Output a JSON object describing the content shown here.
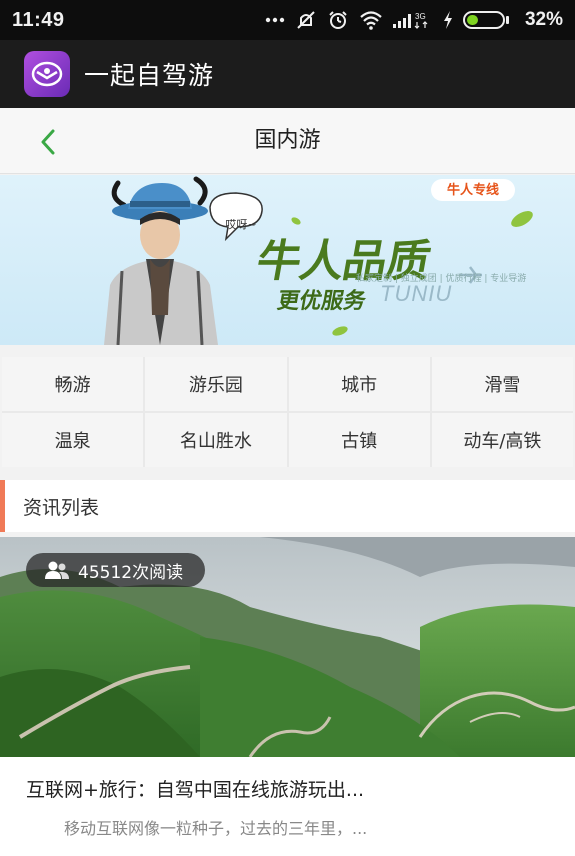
{
  "status_bar": {
    "time": "11:49",
    "signal_label": "3G",
    "battery_percent": "32%",
    "battery_level": 0.32,
    "icons": [
      "more-icon",
      "mute-icon",
      "alarm-icon",
      "wifi-icon",
      "signal-icon",
      "charging-icon",
      "battery-icon"
    ]
  },
  "app_bar": {
    "title": "一起自驾游",
    "icon": "app-logo-icon"
  },
  "header": {
    "title": "国内游",
    "back_icon": "chevron-left-icon"
  },
  "banner": {
    "logo_text": "牛人专线",
    "slogan_main": "牛人品质",
    "slogan_sub": "更优服务",
    "brand": "TUNIU",
    "small_text": "私家定制 | 独立成团 | 优质行程 | 专业导游",
    "speech_text": "哎呀~"
  },
  "categories": [
    {
      "label": "畅游"
    },
    {
      "label": "游乐园"
    },
    {
      "label": "城市"
    },
    {
      "label": "滑雪"
    },
    {
      "label": "温泉"
    },
    {
      "label": "名山胜水"
    },
    {
      "label": "古镇"
    },
    {
      "label": "动车/高铁"
    }
  ],
  "section": {
    "title": "资讯列表"
  },
  "article": {
    "read_count": "45512次阅读",
    "title": "互联网+旅行：自驾中国在线旅游玩出...",
    "summary": "移动互联网像一粒种子，过去的三年里，..."
  },
  "colors": {
    "status_bar_bg": "#0d0d0d",
    "app_bar_bg": "#1c1c1c",
    "accent_green": "#3aa845",
    "section_accent": "#f07a57",
    "battery_green": "#7ed321"
  }
}
